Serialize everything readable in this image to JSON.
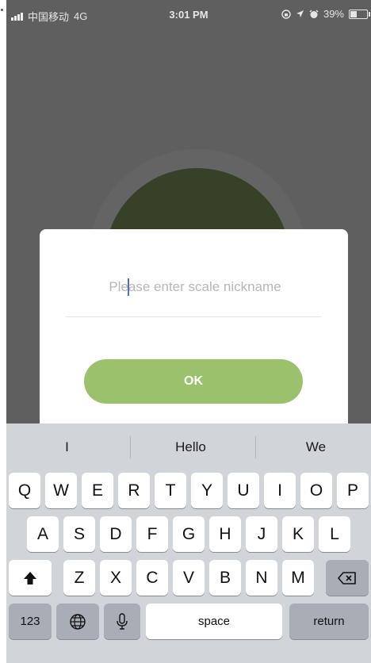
{
  "status_bar": {
    "carrier": "中国移动",
    "network": "4G",
    "time": "3:01 PM",
    "battery": "39%"
  },
  "dialog": {
    "placeholder": "Please enter scale nickname",
    "ok_label": "OK",
    "accent_color": "#9bc16d"
  },
  "keyboard": {
    "suggestions": [
      "I",
      "Hello",
      "We"
    ],
    "row1": [
      "Q",
      "W",
      "E",
      "R",
      "T",
      "Y",
      "U",
      "I",
      "O",
      "P"
    ],
    "row2": [
      "A",
      "S",
      "D",
      "F",
      "G",
      "H",
      "J",
      "K",
      "L"
    ],
    "row3": [
      "Z",
      "X",
      "C",
      "V",
      "B",
      "N",
      "M"
    ],
    "numbers_label": "123",
    "space_label": "space",
    "return_label": "return",
    "icons": [
      "shift-icon",
      "backspace-icon",
      "globe-icon",
      "microphone-icon"
    ]
  }
}
